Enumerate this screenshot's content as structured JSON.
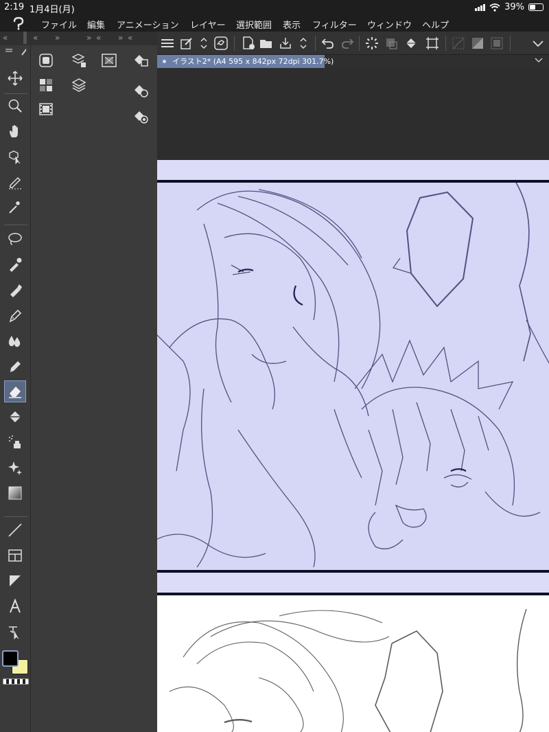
{
  "status": {
    "time": "2:19",
    "date": "1月4日(月)",
    "battery": "39%"
  },
  "menu": {
    "items": [
      "ファイル",
      "編集",
      "アニメーション",
      "レイヤー",
      "選択範囲",
      "表示",
      "フィルター",
      "ウィンドウ",
      "ヘルプ"
    ]
  },
  "document": {
    "tab_title": "イラスト2* (A4 595 x 842px 72dpi 301.7%)"
  },
  "panel_header": {
    "glyphs": [
      "«",
      "«",
      "»",
      "»",
      "«",
      "»",
      "«"
    ]
  },
  "colors": {
    "main": "#000000",
    "sub": "#f4f0a0",
    "accent": "#6b7fa6",
    "page": "#dcdcf8"
  },
  "tools": [
    "move-icon",
    "zoom-icon",
    "hand-icon",
    "object-select-icon",
    "selection-pen-icon",
    "magic-wand-icon",
    "lasso-icon",
    "eyedropper-icon",
    "marker-icon",
    "pen-icon",
    "watercolor-icon",
    "pencil-icon",
    "eraser-icon",
    "fill-icon",
    "airbrush-icon",
    "decoration-icon",
    "gradient-icon",
    "line-icon",
    "frame-border-icon",
    "ruler-icon",
    "text-icon",
    "balloon-tail-icon"
  ]
}
